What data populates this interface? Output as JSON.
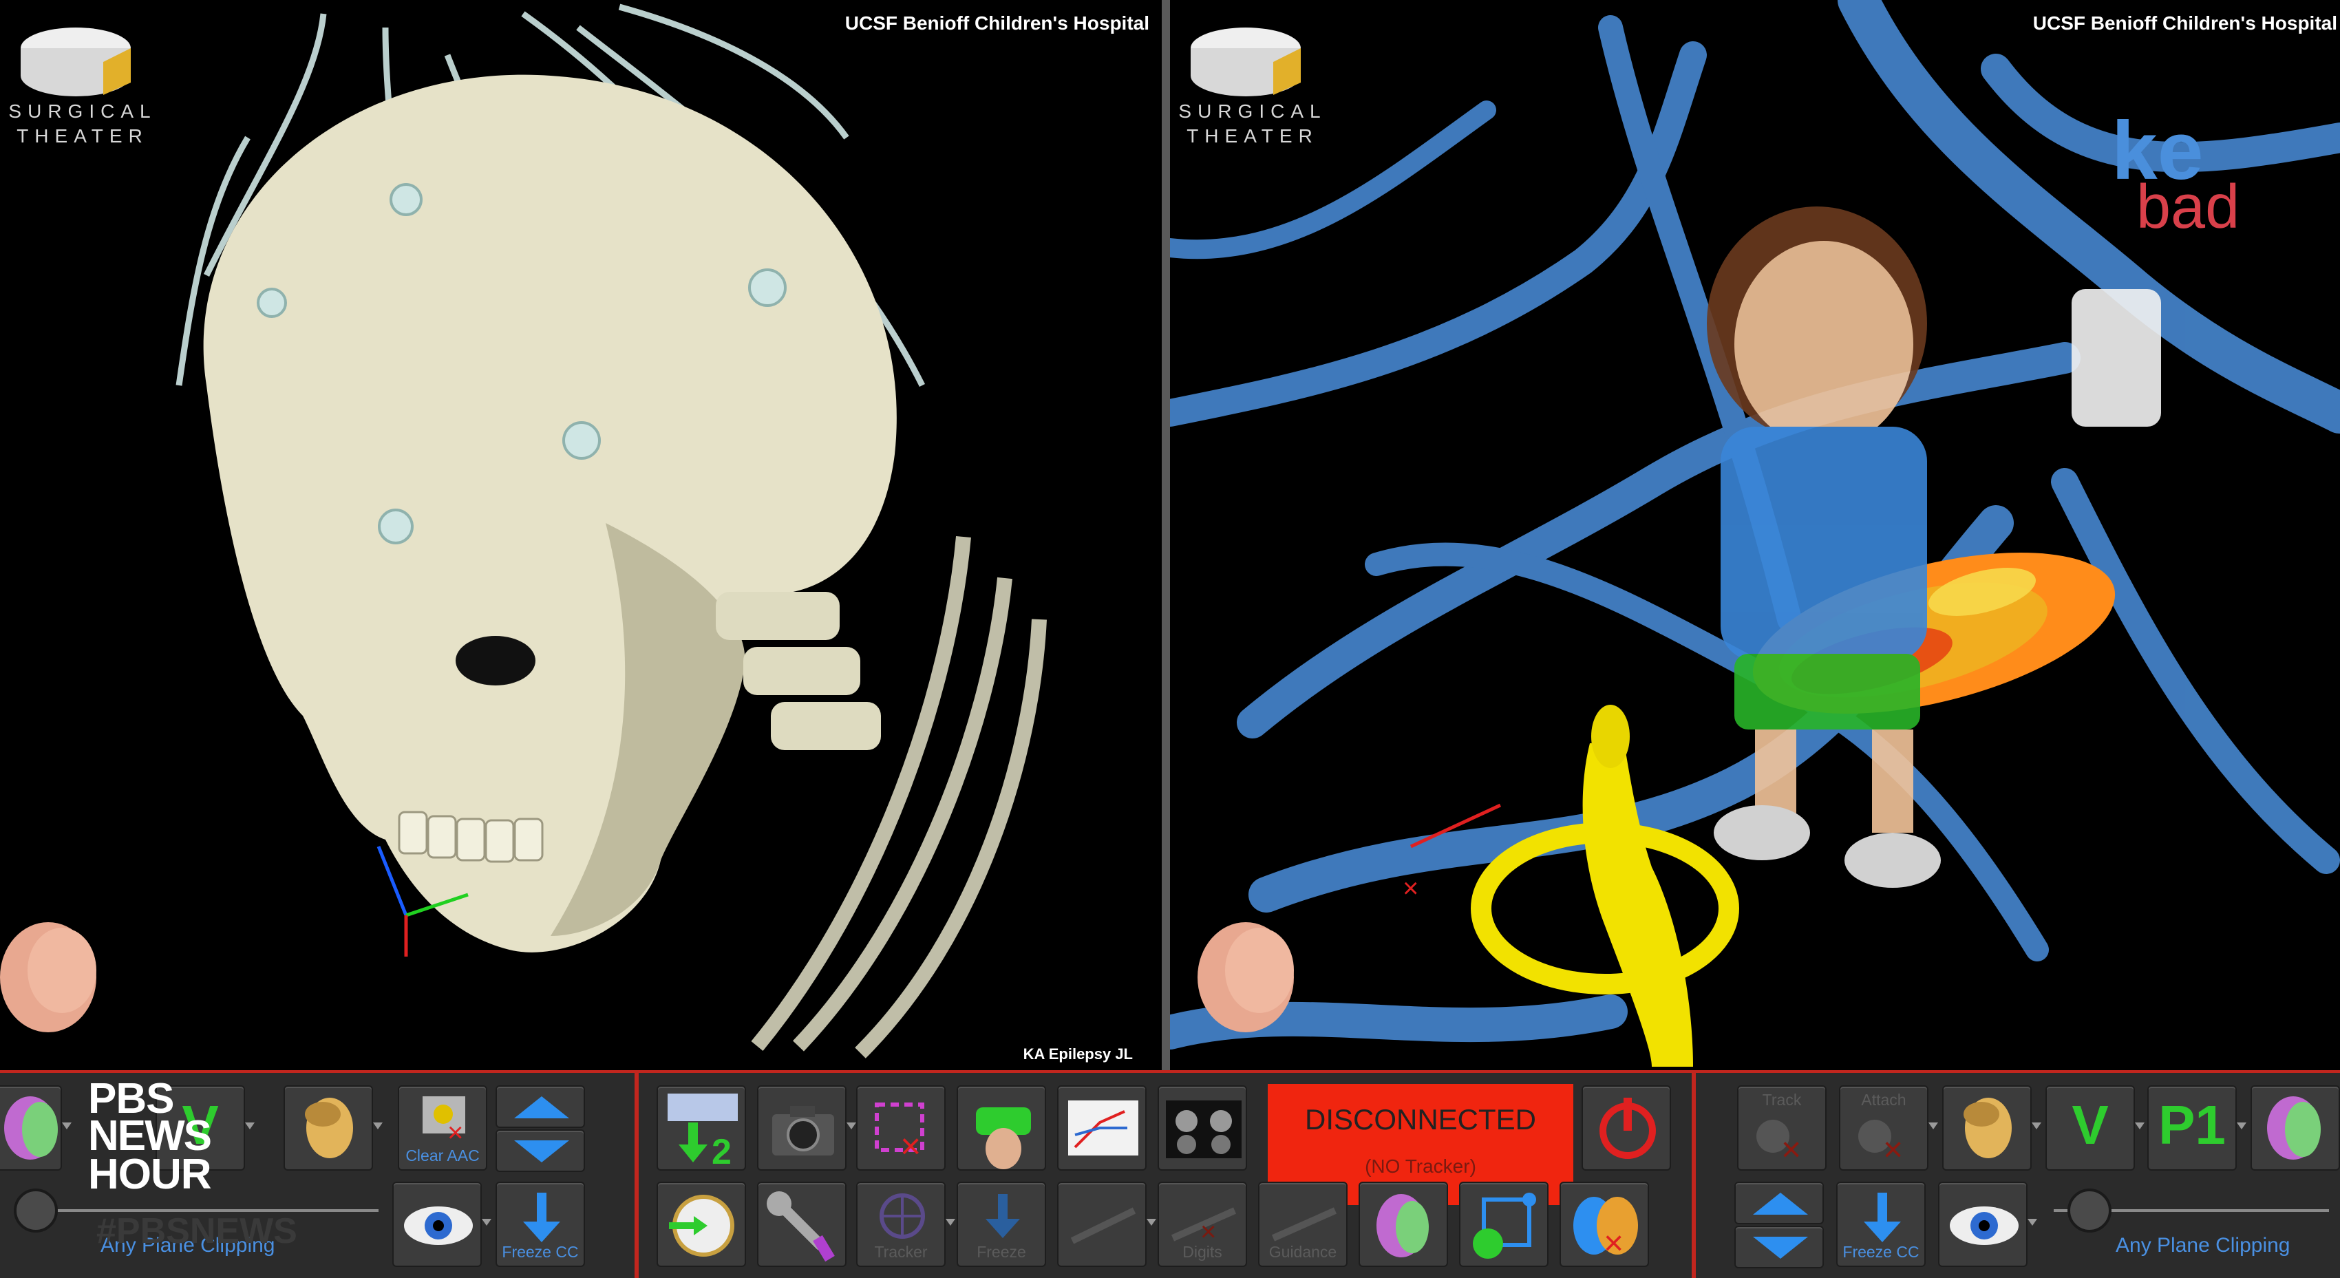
{
  "left_viewport": {
    "hospital": "UCSF Benioff Children's Hospital",
    "logo_line1": "SURGICAL",
    "logo_line2": "THEATER",
    "footnote": "KA Epilepsy JL"
  },
  "right_viewport": {
    "hospital": "UCSF Benioff Children's Hospital",
    "logo_line1": "SURGICAL",
    "logo_line2": "THEATER",
    "overlay_text_1": "ke",
    "overlay_text_2": "bad"
  },
  "toolbar": {
    "left": {
      "clear_aac": "Clear AAC",
      "freeze_cc": "Freeze CC",
      "any_plane_clipping": "Any Plane Clipping",
      "v_letter": "V",
      "clipping_slider_level": 0.05
    },
    "center": {
      "tracker": "Tracker",
      "freeze": "Freeze",
      "digits": "Digits",
      "guidance": "Guidance",
      "status_title": "DISCONNECTED",
      "status_sub": "(NO Tracker)"
    },
    "right": {
      "track": "Track",
      "attach": "Attach",
      "v_letter": "V",
      "p1_letter": "P1",
      "freeze_cc": "Freeze CC",
      "any_plane_clipping": "Any Plane Clipping",
      "clipping_slider_level": 0.05
    }
  },
  "overlay": {
    "pbs_line1": "PBS",
    "pbs_line2": "NEWS",
    "pbs_line3": "HOUR",
    "watermark": "#PBSNEWS"
  },
  "colors": {
    "accent_red": "#c2261e",
    "status_red": "#f0250f",
    "label_blue": "#4a90e2",
    "letter_green": "#2ecc2e",
    "skull": "#e6e2c8",
    "vessel": "#4a8fdc"
  }
}
